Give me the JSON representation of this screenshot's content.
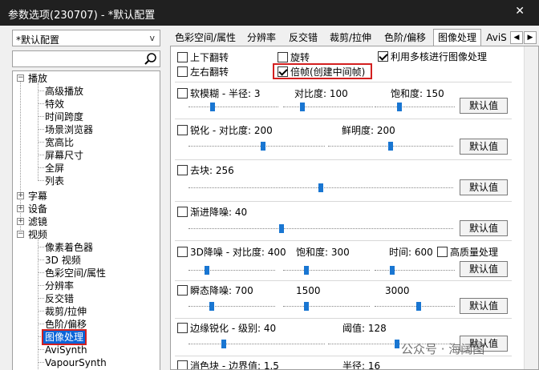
{
  "window": {
    "title": "参数选项(230707) - *默认配置",
    "close_glyph": "✕"
  },
  "preset": {
    "value": "*默认配置",
    "arrow": "v"
  },
  "search": {
    "value": ""
  },
  "tree": {
    "playback": {
      "label": "播放",
      "toggle": "−"
    },
    "playback_children": [
      "高级播放",
      "特效",
      "时间跨度",
      "场景浏览器",
      "宽高比",
      "屏幕尺寸",
      "全屏",
      "列表"
    ],
    "subtitles": {
      "label": "字幕",
      "toggle": "+"
    },
    "devices": {
      "label": "设备",
      "toggle": "+"
    },
    "filters": {
      "label": "滤镜",
      "toggle": "+"
    },
    "video": {
      "label": "视频",
      "toggle": "−"
    },
    "video_children": [
      "像素着色器",
      "3D 视频",
      "色彩空间/属性",
      "分辨率",
      "反交错",
      "裁剪/拉伸",
      "色阶/偏移",
      "图像处理",
      "AviSynth",
      "VapourSynth"
    ],
    "selected": "图像处理"
  },
  "tabs": [
    "色彩空间/属性",
    "分辨率",
    "反交错",
    "裁剪/拉伸",
    "色阶/偏移",
    "图像处理",
    "AviS"
  ],
  "tab_nav": {
    "prev": "◀",
    "next": "▶"
  },
  "options": {
    "flip_v": {
      "label": "上下翻转",
      "checked": false
    },
    "rotate": {
      "label": "旋转",
      "checked": false
    },
    "multicore": {
      "label": "利用多核进行图像处理",
      "checked": true
    },
    "flip_h": {
      "label": "左右翻转",
      "checked": false
    },
    "double_frame": {
      "label": "倍帧(创建中间帧)",
      "checked": true
    }
  },
  "sections": {
    "blur": {
      "label": "软模糊 - 半径: 3",
      "contrast": "对比度: 100",
      "saturation": "饱和度: 150",
      "radius_pct": 0.25,
      "contrast_pct": 0.2,
      "saturation_pct": 0.3
    },
    "sharpen": {
      "label": "锐化 - 对比度: 200",
      "brightness": "鲜明度: 200",
      "contrast_pct": 0.55,
      "brightness_pct": 0.5
    },
    "deblock": {
      "label": "去块: 256",
      "strength_pct": 0.5
    },
    "progressive_denoise": {
      "label": "渐进降噪: 40",
      "strength_pct": 0.35
    },
    "denoise3d": {
      "label": "3D降噪 - 对比度: 400",
      "saturation": "饱和度: 300",
      "time": "时间: 600",
      "hq": "高质量处理",
      "contrast_pct": 0.2,
      "saturation_pct": 0.25,
      "time_pct": 0.2
    },
    "transient": {
      "label": "瞬态降噪: 700",
      "v2": "1500",
      "v3": "3000",
      "p1_pct": 0.25,
      "p2_pct": 0.25,
      "p3_pct": 0.55
    },
    "edge_sharpen": {
      "label": "边缘锐化 - 级别: 40",
      "threshold": "阈值: 128",
      "level_pct": 0.25,
      "threshold_pct": 0.55
    },
    "deband": {
      "label": "消色块 - 边界值: 1.5",
      "radius": "半径: 16"
    }
  },
  "default_label": "默认值",
  "watermark": "公众号 · 海阔图"
}
